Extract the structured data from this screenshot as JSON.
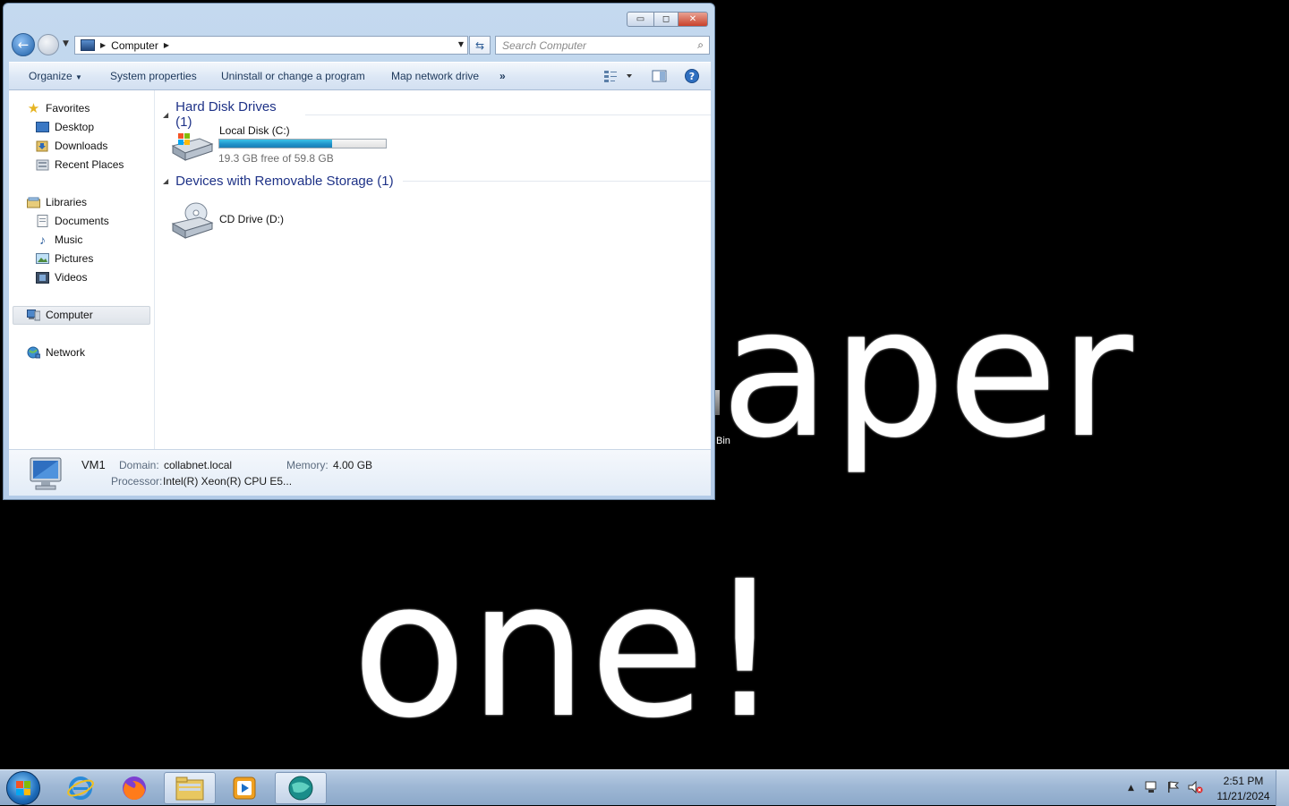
{
  "desktop": {
    "wallpaper_line1": "aper",
    "wallpaper_line2": "one!",
    "icon_label": "Bin"
  },
  "window": {
    "caption_buttons": {
      "minimize": "▭",
      "maximize": "◻",
      "close": "✕"
    },
    "address": {
      "crumb": "Computer"
    },
    "search": {
      "placeholder": "Search Computer"
    },
    "toolbar": {
      "organize": "Organize",
      "system_properties": "System properties",
      "uninstall": "Uninstall or change a program",
      "map_drive": "Map network drive",
      "more": "»"
    },
    "nav_pane": {
      "favorites": "Favorites",
      "desktop": "Desktop",
      "downloads": "Downloads",
      "recent_places": "Recent Places",
      "libraries": "Libraries",
      "documents": "Documents",
      "music": "Music",
      "pictures": "Pictures",
      "videos": "Videos",
      "computer": "Computer",
      "network": "Network"
    },
    "content": {
      "hdd_group": "Hard Disk Drives (1)",
      "local_disk_name": "Local Disk (C:)",
      "local_disk_free": "19.3 GB free of 59.8 GB",
      "local_disk_used_fraction": 0.677,
      "removable_group": "Devices with Removable Storage (1)",
      "cd_drive_name": "CD Drive (D:)"
    },
    "details": {
      "computer_name": "VM1",
      "domain_label": "Domain:",
      "domain_value": "collabnet.local",
      "memory_label": "Memory:",
      "memory_value": "4.00 GB",
      "processor_label": "Processor:",
      "processor_value": "Intel(R) Xeon(R) CPU E5..."
    }
  },
  "taskbar": {
    "clock_time": "2:51 PM",
    "clock_date": "11/21/2024"
  },
  "colors": {
    "accent_blue": "#1e3287",
    "progress_fill": "#1f90c8",
    "taskbar": "#9fb8d5"
  }
}
